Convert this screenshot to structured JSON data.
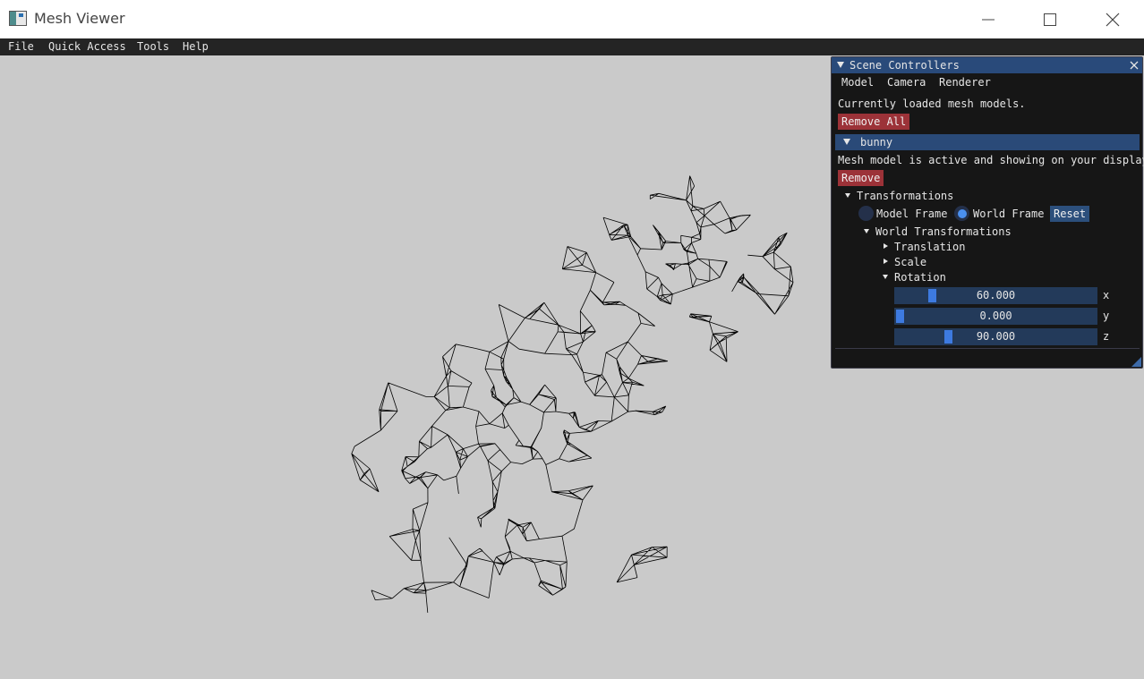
{
  "window": {
    "title": "Mesh Viewer"
  },
  "menu": {
    "items": [
      "File",
      "Quick Access",
      "Tools",
      "Help"
    ]
  },
  "panel": {
    "title": "Scene Controllers",
    "tabs": [
      "Model",
      "Camera",
      "Renderer"
    ],
    "loaded_text": "Currently loaded mesh models.",
    "remove_all": "Remove All",
    "model_name": "bunny",
    "active_text": "Mesh model is active and showing on your display",
    "remove": "Remove",
    "transformations": "Transformations",
    "frame_options": {
      "model": "Model Frame",
      "world": "World Frame",
      "selected": "World Frame"
    },
    "reset": "Reset",
    "world_transformations": "World Transformations",
    "translation": "Translation",
    "scale": "Scale",
    "rotation": "Rotation",
    "rotation_values": [
      {
        "axis": "x",
        "value": "60.000",
        "fraction": 0.17
      },
      {
        "axis": "y",
        "value": "0.000",
        "fraction": 0.0
      },
      {
        "axis": "z",
        "value": "90.000",
        "fraction": 0.25
      }
    ]
  },
  "colors": {
    "viewport": "#cacaca",
    "menubar": "#242424",
    "panel_title": "#294a7a",
    "button_red": "#9c3238",
    "accent_blue": "#3d7ae0"
  }
}
